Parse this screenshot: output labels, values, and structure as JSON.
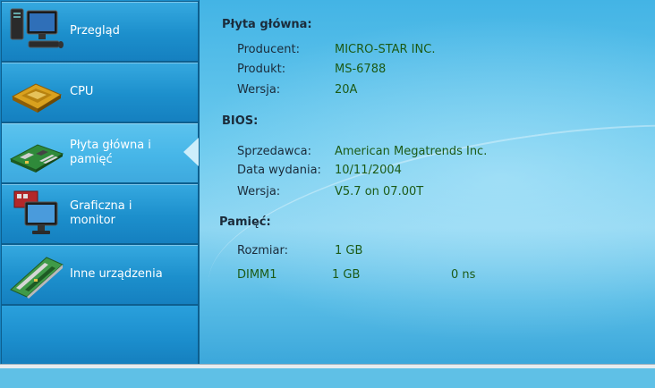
{
  "sidebar": {
    "items": [
      {
        "label": "Przegląd",
        "icon": "desktop-computer-icon"
      },
      {
        "label": "CPU",
        "icon": "cpu-chip-icon"
      },
      {
        "label": "Płyta główna i pamięć",
        "icon": "motherboard-icon"
      },
      {
        "label": "Graficzna i monitor",
        "icon": "monitor-icon"
      },
      {
        "label": "Inne urządzenia",
        "icon": "expansion-card-icon"
      }
    ],
    "active_index": 2
  },
  "sections": {
    "motherboard": {
      "title": "Płyta główna:",
      "rows": [
        {
          "key": "Producent:",
          "value": "MICRO-STAR INC."
        },
        {
          "key": "Produkt:",
          "value": "MS-6788"
        },
        {
          "key": "Wersja:",
          "value": "20A"
        }
      ]
    },
    "bios": {
      "title": "BIOS:",
      "rows": [
        {
          "key": "Sprzedawca:",
          "value": "American Megatrends Inc."
        },
        {
          "key": "Data wydania:",
          "value": "10/11/2004"
        },
        {
          "key": "Wersja:",
          "value": "V5.7 on 07.00T"
        }
      ]
    },
    "memory": {
      "title": "Pamięć:",
      "size_key": "Rozmiar:",
      "size_value": "1 GB",
      "modules": [
        {
          "slot": "DIMM1",
          "size": "1 GB",
          "speed": "0 ns"
        }
      ]
    }
  },
  "colors": {
    "sidebar_bg": "#1d92cf",
    "main_bg": "#6ccaee",
    "value_text": "#1c5a16",
    "label_text": "#1b2b3a"
  }
}
